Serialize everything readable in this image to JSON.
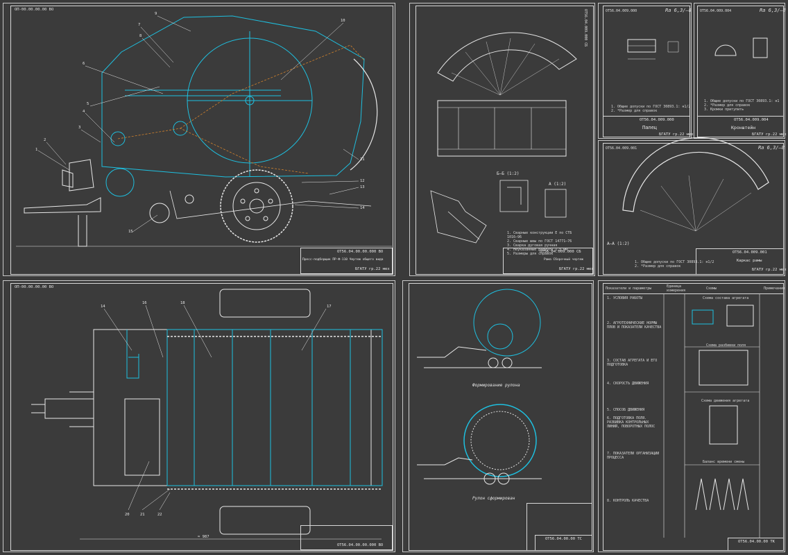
{
  "sheets": {
    "general_view": {
      "code_top": "ОП-00.00.00.00 ВО",
      "stamp_code": "ОТ56.04.00.00.000 ВО",
      "stamp_title": "Пресс-подборщик ПР-Ф-110 Чертеж общего вида",
      "stamp_org": "БГАТУ гр.22 мех",
      "callouts": [
        "1",
        "2",
        "3",
        "4",
        "5",
        "6",
        "7",
        "8",
        "9",
        "10",
        "11",
        "12",
        "13",
        "14",
        "15"
      ]
    },
    "frame_detail": {
      "code_top": "ОТ56.04.009.000 СБ",
      "section_bb": "Б–Б (1:2)",
      "section_a": "А (1:2)",
      "stamp_code": "ОТ56.04.009.000 СБ",
      "stamp_title": "Рама Сборочный чертеж",
      "stamp_org": "БГАТУ гр.22 мех",
      "notes": [
        "1. Сварные конструкции Е по СТБ 1016–96",
        "2. Сварные швы по ГОСТ 14771–76",
        "3. Сварка дуговая ручная",
        "4. Неуказанные радиусы 1,5 мм",
        "5. Размеры для справок"
      ]
    },
    "part_a": {
      "code_top": "ОТ56.04.009.000",
      "roughness": "Ra 6,3/–8",
      "stamp_code": "ОТ56.04.009.000",
      "stamp_title": "Палец",
      "stamp_org": "БГАТУ гр.22 мех",
      "notes": [
        "1. Общие допуски по ГОСТ 30893.1: н1/2",
        "2. *Размер для справок"
      ]
    },
    "part_b": {
      "code_top": "ОТ56.04.009.004",
      "roughness": "Ra 6,3/–8",
      "stamp_code": "ОТ56.04.009.004",
      "stamp_title": "Кронштейн",
      "stamp_org": "БГАТУ гр.22 мех",
      "notes": [
        "1. Общие допуски по ГОСТ 30893.1: н1",
        "2. *Размер для справок",
        "3. Кромки притупить"
      ]
    },
    "part_c": {
      "code_top": "ОТ56.04.009.001",
      "roughness": "Ra 6,3/–8",
      "section": "А–А (1:2)",
      "stamp_code": "ОТ56.04.009.001",
      "stamp_title": "Каркас рамы",
      "stamp_org": "БГАТУ гр.22 мех",
      "notes": [
        "1. Общие допуски по ГОСТ 30893.1: н1/2",
        "2. *Размер для справок"
      ]
    },
    "plan_view": {
      "code_top": "ОП-00.00.00.00 ВО",
      "stamp_code": "ОТ56.04.00.00.000 ВО",
      "dimension": "≈ 987",
      "callouts": [
        "14",
        "16",
        "18",
        "17",
        "20",
        "21",
        "22"
      ]
    },
    "process": {
      "caption_top": "Формирование рулона",
      "caption_bottom": "Рулон сформирован",
      "stamp_code": "ОТ56.04.00.00 ТС"
    },
    "tech_map": {
      "header": [
        "Показатели и параметры",
        "Единица измерения",
        "Схемы",
        "Примечание"
      ],
      "sections": [
        "1. УСЛОВИЯ РАБОТЫ",
        "2. АГРОТЕХНИЧЕСКИЕ НОРМЫ ПЛОВ И ПОКАЗАТЕЛИ КАЧЕСТВА",
        "3. СОСТАВ АГРЕГАТА И ЕГО ПОДГОТОВКА",
        "4. СКОРОСТЬ ДВИЖЕНИЯ",
        "5. СПОСОБ ДВИЖЕНИЯ",
        "6. ПОДГОТОВКА ПОЛЯ. РАЗБИВКА КОНТРОЛЬНЫХ ЛИНИЙ, ПОВОРОТНЫХ ПОЛОС",
        "7. ПОКАЗАТЕЛИ ОРГАНИЗАЦИИ ПРОЦЕССА",
        "8. КОНТРОЛЬ КАЧЕСТВА"
      ],
      "scheme_titles": [
        "Схема состава агрегата",
        "Схема разбивки поля",
        "Схема движения агрегата",
        "Баланс времени смены"
      ],
      "stamp_code": "ОТ56.04.00.00 ТК"
    }
  }
}
